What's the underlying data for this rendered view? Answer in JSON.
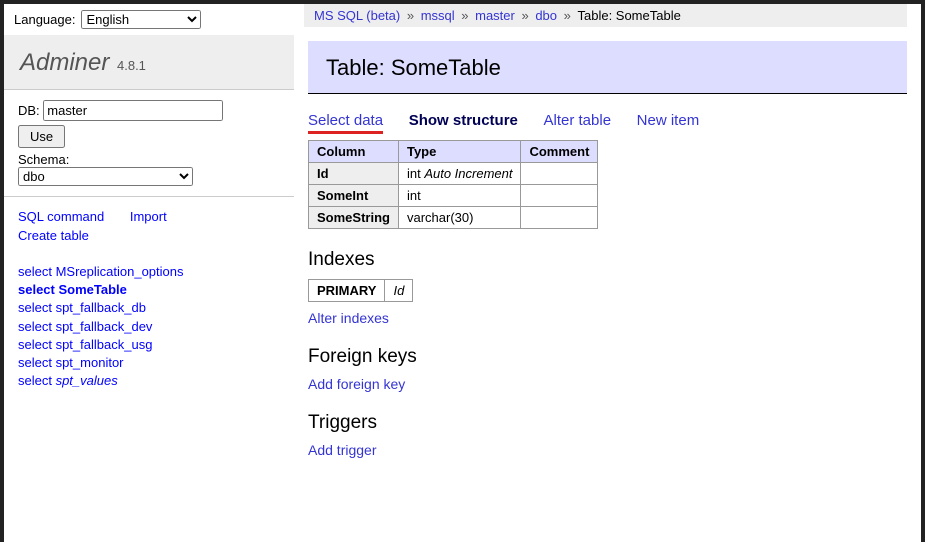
{
  "lang": {
    "label": "Language:",
    "value": "English"
  },
  "app": {
    "name": "Adminer",
    "version": "4.8.1"
  },
  "sidebar": {
    "db_label": "DB:",
    "db_value": "master",
    "use_btn": "Use",
    "schema_label": "Schema:",
    "schema_value": "dbo",
    "sql_command": "SQL command",
    "import": "Import",
    "create_table": "Create table",
    "tables": [
      {
        "prefix": "select ",
        "name": "MSreplication_options",
        "active": false,
        "italic": false
      },
      {
        "prefix": "select ",
        "name": "SomeTable",
        "active": true,
        "italic": false
      },
      {
        "prefix": "select ",
        "name": "spt_fallback_db",
        "active": false,
        "italic": false
      },
      {
        "prefix": "select ",
        "name": "spt_fallback_dev",
        "active": false,
        "italic": false
      },
      {
        "prefix": "select ",
        "name": "spt_fallback_usg",
        "active": false,
        "italic": false
      },
      {
        "prefix": "select ",
        "name": "spt_monitor",
        "active": false,
        "italic": false
      },
      {
        "prefix": "select ",
        "name": "spt_values",
        "active": false,
        "italic": true
      }
    ]
  },
  "breadcrumb": {
    "parts": [
      "MS SQL (beta)",
      "mssql",
      "master",
      "dbo"
    ],
    "last": "Table: SomeTable",
    "sep": "»"
  },
  "heading": "Table: SomeTable",
  "tabs": {
    "select_data": "Select data",
    "show_structure": "Show structure",
    "alter_table": "Alter table",
    "new_item": "New item"
  },
  "columns": {
    "headers": [
      "Column",
      "Type",
      "Comment"
    ],
    "rows": [
      {
        "name": "Id",
        "type": "int ",
        "ai": "Auto Increment",
        "comment": ""
      },
      {
        "name": "SomeInt",
        "type": "int",
        "ai": "",
        "comment": ""
      },
      {
        "name": "SomeString",
        "type": "varchar(30)",
        "ai": "",
        "comment": ""
      }
    ]
  },
  "indexes": {
    "title": "Indexes",
    "rows": [
      {
        "type": "PRIMARY",
        "col": "Id"
      }
    ],
    "alter": "Alter indexes"
  },
  "fk": {
    "title": "Foreign keys",
    "add": "Add foreign key"
  },
  "triggers": {
    "title": "Triggers",
    "add": "Add trigger"
  }
}
